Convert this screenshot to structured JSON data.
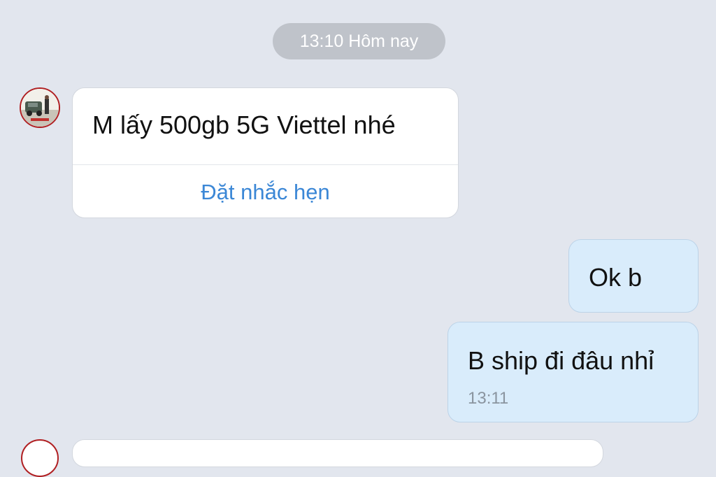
{
  "chat": {
    "date_separator": "13:10 Hôm nay",
    "messages": [
      {
        "direction": "incoming",
        "text": "M lấy 500gb 5G Viettel nhé",
        "action_label": "Đặt nhắc hẹn"
      },
      {
        "direction": "outgoing",
        "text": "Ok b"
      },
      {
        "direction": "outgoing",
        "text": "B ship đi đâu nhỉ",
        "time": "13:11"
      }
    ]
  },
  "colors": {
    "background": "#e2e6ee",
    "incoming_bubble": "#ffffff",
    "outgoing_bubble": "#d9ecfb",
    "action_text": "#3b87d6",
    "avatar_border": "#b01f22"
  }
}
